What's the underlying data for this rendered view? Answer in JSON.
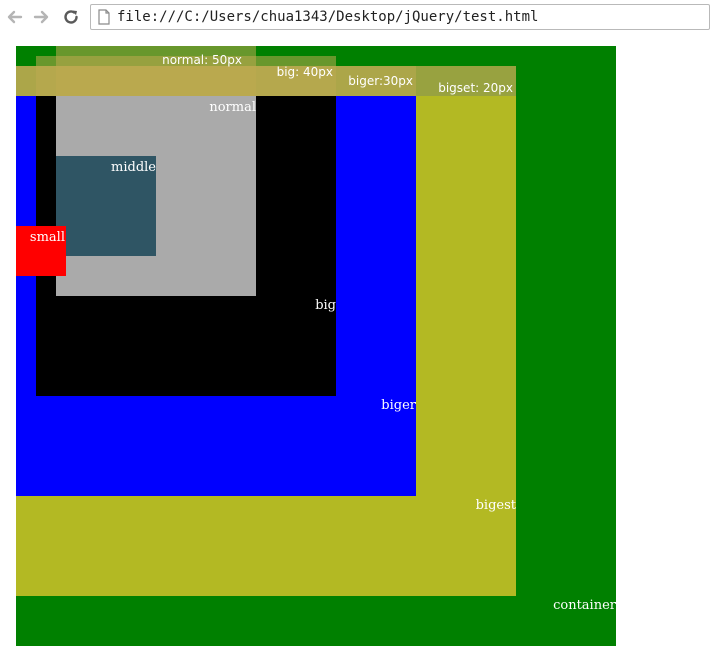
{
  "browser": {
    "url": "file:///C:/Users/chua1343/Desktop/jQuery/test.html"
  },
  "boxes": {
    "container": {
      "label": "container",
      "color": "#008000"
    },
    "bigest": {
      "label": "bigest",
      "color": "#b3b923"
    },
    "biger": {
      "label": "biger",
      "color": "#0000ff"
    },
    "big": {
      "label": "big",
      "color": "#000000"
    },
    "normal": {
      "label": "normal",
      "color": "#aaaaaa"
    },
    "middle": {
      "label": "middle",
      "color": "#2f5564"
    },
    "small": {
      "label": "small",
      "color": "#ff0000"
    }
  },
  "tags": {
    "normal": "normal: 50px",
    "big": "big: 40px",
    "biger": "biger:30px",
    "bigest": "bigset: 20px"
  }
}
